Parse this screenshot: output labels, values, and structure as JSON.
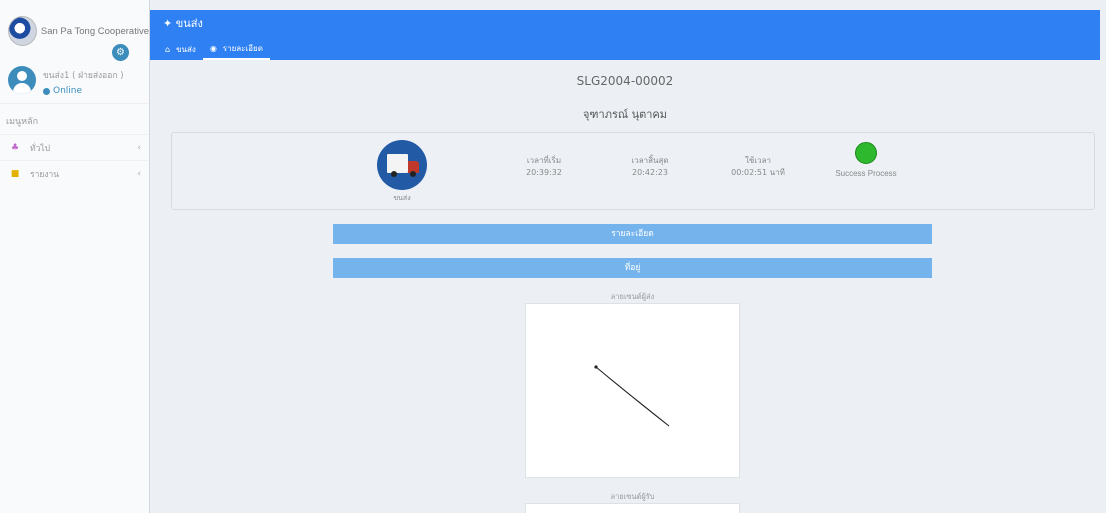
{
  "sidebar": {
    "brand": "San Pa Tong Cooperative",
    "user": {
      "name": "ขนส่ง1 ( ฝ่ายส่งออก )",
      "status": "Online"
    },
    "menu_header": "เมนูหลัก",
    "items": [
      {
        "label": "ทั่วไป",
        "icon": "general-icon"
      },
      {
        "label": "รายงาน",
        "icon": "report-icon"
      }
    ]
  },
  "header": {
    "title": "ขนส่ง",
    "tabs": [
      {
        "label": "ขนส่ง",
        "icon": "home-icon"
      },
      {
        "label": "รายละเอียด",
        "icon": "info-icon",
        "active": true
      }
    ]
  },
  "main": {
    "doc_number": "SLG2004-00002",
    "customer": "จุฑาภรณ์ นุตาคม",
    "truck_label": "ขนส่ง",
    "stats": {
      "start": {
        "label": "เวลาที่เริ่ม",
        "value": "20:39:32"
      },
      "end": {
        "label": "เวลาสิ้นสุด",
        "value": "20:42:23"
      },
      "duration": {
        "label": "ใช้เวลา",
        "value": "00:02:51 นาที"
      }
    },
    "status_label": "Success Process",
    "status_color": "#2db82d",
    "sections": {
      "detail": "รายละเอียด",
      "address": "ที่อยู่"
    },
    "signatures": {
      "sender": "ลายเซนต์ผู้ส่ง",
      "receiver": "ลายเซนต์ผู้รับ"
    }
  },
  "colors": {
    "accent": "#2f80f2",
    "bar": "#74b3ec",
    "truck": "#225aa5"
  }
}
